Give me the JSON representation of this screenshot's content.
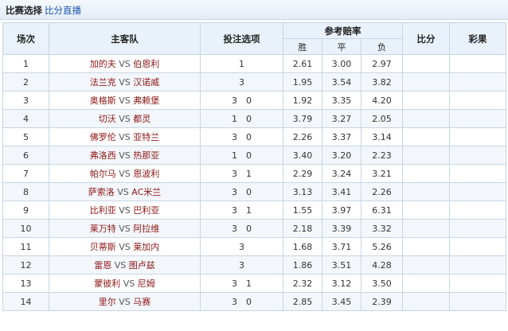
{
  "topbar": {
    "title": "比赛选择",
    "link": "比分直播"
  },
  "headers": {
    "index": "场次",
    "teams": "主客队",
    "picks": "投注选项",
    "odds": "参考赔率",
    "win": "胜",
    "draw": "平",
    "loss": "负",
    "score": "比分",
    "result": "彩果"
  },
  "rows": [
    {
      "no": "1",
      "home": "加的夫",
      "vs": "VS",
      "away": "伯恩利",
      "pick": "1",
      "win": "2.61",
      "draw": "3.00",
      "loss": "2.97"
    },
    {
      "no": "2",
      "home": "法兰克",
      "vs": "VS",
      "away": "汉诺威",
      "pick": "3",
      "win": "1.95",
      "draw": "3.54",
      "loss": "3.82"
    },
    {
      "no": "3",
      "home": "奥格斯",
      "vs": "VS",
      "away": "弗赖堡",
      "pick": "3 0",
      "win": "1.92",
      "draw": "3.35",
      "loss": "4.20"
    },
    {
      "no": "4",
      "home": "切沃",
      "vs": "VS",
      "away": "都灵",
      "pick": "1 0",
      "win": "3.79",
      "draw": "3.27",
      "loss": "2.05"
    },
    {
      "no": "5",
      "home": "佛罗伦",
      "vs": "VS",
      "away": "亚特兰",
      "pick": "3 0",
      "win": "2.26",
      "draw": "3.37",
      "loss": "3.14"
    },
    {
      "no": "6",
      "home": "弗洛西",
      "vs": "VS",
      "away": "热那亚",
      "pick": "1 0",
      "win": "3.40",
      "draw": "3.20",
      "loss": "2.23"
    },
    {
      "no": "7",
      "home": "帕尔马",
      "vs": "VS",
      "away": "恩波利",
      "pick": "3 1",
      "win": "2.29",
      "draw": "3.24",
      "loss": "3.21"
    },
    {
      "no": "8",
      "home": "萨索洛",
      "vs": "VS",
      "away": "AC米兰",
      "pick": "3 0",
      "win": "3.13",
      "draw": "3.41",
      "loss": "2.26"
    },
    {
      "no": "9",
      "home": "比利亚",
      "vs": "VS",
      "away": "巴利亚",
      "pick": "3 1",
      "win": "1.55",
      "draw": "3.97",
      "loss": "6.31"
    },
    {
      "no": "10",
      "home": "莱万特",
      "vs": "VS",
      "away": "阿拉维",
      "pick": "3 0",
      "win": "2.18",
      "draw": "3.39",
      "loss": "3.32"
    },
    {
      "no": "11",
      "home": "贝蒂斯",
      "vs": "VS",
      "away": "莱加内",
      "pick": "3",
      "win": "1.68",
      "draw": "3.71",
      "loss": "5.26"
    },
    {
      "no": "12",
      "home": "雷恩",
      "vs": "VS",
      "away": "图卢兹",
      "pick": "3",
      "win": "1.86",
      "draw": "3.51",
      "loss": "4.28"
    },
    {
      "no": "13",
      "home": "蒙彼利",
      "vs": "VS",
      "away": "尼姆",
      "pick": "3 1",
      "win": "2.32",
      "draw": "3.12",
      "loss": "3.50"
    },
    {
      "no": "14",
      "home": "里尔",
      "vs": "VS",
      "away": "马赛",
      "pick": "3 0",
      "win": "2.85",
      "draw": "3.45",
      "loss": "2.39"
    }
  ]
}
